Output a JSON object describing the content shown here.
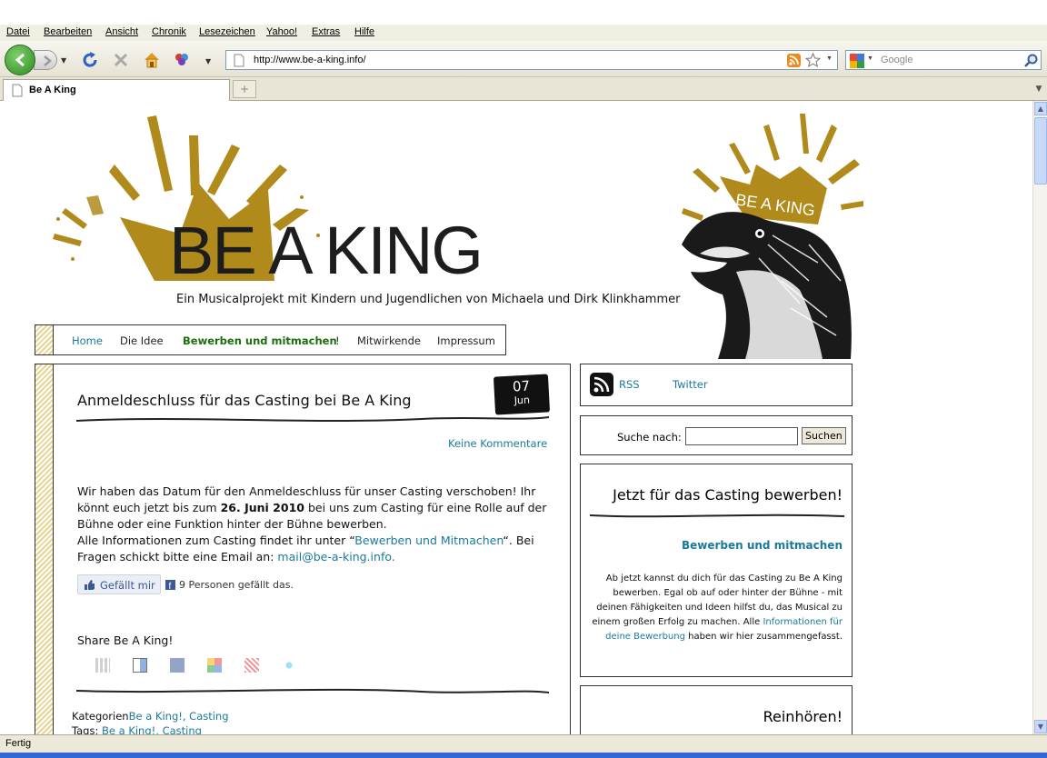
{
  "browser": {
    "menu": [
      "Datei",
      "Bearbeiten",
      "Ansicht",
      "Chronik",
      "Lesezeichen",
      "Yahoo!",
      "Extras",
      "Hilfe"
    ],
    "url": "http://www.be-a-king.info/",
    "search_placeholder": "Google",
    "tab_title": "Be A King",
    "status": "Fertig",
    "icons": [
      "back-icon",
      "forward-icon",
      "reload-icon",
      "stop-icon",
      "home-icon",
      "addon-icon",
      "rss-icon",
      "star-icon",
      "search-icon"
    ]
  },
  "site": {
    "logo": "BE A KING",
    "crown_text": "BE A KING",
    "tagline": "Ein Musicalprojekt mit Kindern und Jugendlichen von Michaela und Dirk Klinkhammer",
    "nav": [
      "Home",
      "Die Idee",
      "Bewerben und mitmachen",
      "!",
      "Mitwirkende",
      "Impressum"
    ],
    "colors": {
      "gold": "#b08a1a",
      "link": "#1a7a9c",
      "green": "#1b6e0b"
    }
  },
  "post": {
    "title": "Anmeldeschluss für das Casting bei Be A King",
    "date_day": "07",
    "date_month": "Jun",
    "comments": "Keine Kommentare",
    "body1": "Wir haben das Datum für den Anmeldeschluss für unser Casting verschoben! Ihr könnt euch jetzt bis zum",
    "body_bold": "26. Juni 2010",
    "body2": "bei uns zum Casting für eine Rolle auf der Bühne oder eine Funktion hinter der Bühne bewerben.",
    "body3": "Alle Informationen zum Casting findet ihr unter “",
    "body_link": "Bewerben und Mitmachen",
    "body4": "“. Bei Fragen schickt bitte eine Email an:",
    "email": "mail@be-a-king.info.",
    "like_label": "Gefällt mir",
    "like_count": "9 Personen gefällt das.",
    "share_title": "Share Be A King!",
    "categories_label": "Kategorien",
    "categories": "Be a King!, Casting",
    "tags_label": "Tags:",
    "tags": "Be a King!, Casting"
  },
  "sidebar": {
    "rss": "RSS",
    "twitter": "Twitter",
    "search_label": "Suche nach:",
    "search_button": "Suchen",
    "casting_title": "Jetzt für das Casting bewerben!",
    "casting_link": "Bewerben und mitmachen",
    "casting_text1": "Ab jetzt kannst du dich für das Casting zu Be A King bewerben. Egal ob auf oder hinter der Bühne - mit deinen Fähigkeiten und Ideen hilfst du, das Musical zu einem großen Erfolg zu machen. Alle",
    "casting_link2": "Informationen für deine Bewerbung",
    "casting_text2": "haben wir hier zusammengefasst.",
    "listen_title": "Reinhören!"
  }
}
